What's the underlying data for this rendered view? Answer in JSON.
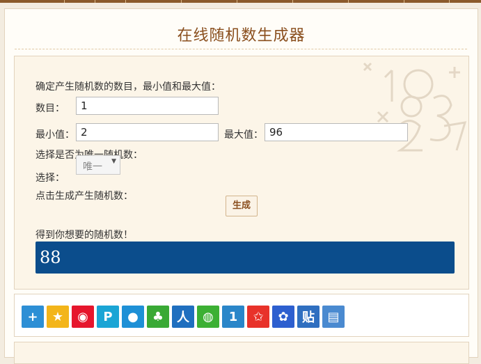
{
  "title": "在线随机数生成器",
  "form": {
    "intro": "确定产生随机数的数目，最小值和最大值：",
    "count_label": "数目：",
    "count_value": "1",
    "min_label": "最小值：",
    "min_value": "2",
    "max_label": "最大值：",
    "max_value": "96",
    "unique_prompt": "选择是否为唯一随机数：",
    "select_label": "选择：",
    "select_value": "唯一",
    "generate_prompt": "点击生成产生随机数：",
    "generate_button": "生成",
    "result_label": "得到你想要的随机数！",
    "result_value": "88"
  },
  "share_icons": [
    {
      "name": "more-share-icon",
      "color": "#2d8fd5",
      "glyph": "+"
    },
    {
      "name": "qzone-icon",
      "color": "#f3b51a",
      "glyph": "★"
    },
    {
      "name": "weibo-icon",
      "color": "#e6162d",
      "glyph": "◉"
    },
    {
      "name": "tencent-weibo-icon",
      "color": "#1aa5d5",
      "glyph": "P"
    },
    {
      "name": "qq-icon",
      "color": "#1e90d6",
      "glyph": "●"
    },
    {
      "name": "clover-icon",
      "color": "#39a935",
      "glyph": "♣"
    },
    {
      "name": "renren-icon",
      "color": "#1f6fbf",
      "glyph": "人"
    },
    {
      "name": "wechat-icon",
      "color": "#3cb034",
      "glyph": "◍"
    },
    {
      "name": "kaixin-icon",
      "color": "#2a86c9",
      "glyph": "1"
    },
    {
      "name": "favorite-star-icon",
      "color": "#e8322a",
      "glyph": "✩"
    },
    {
      "name": "baidu-icon",
      "color": "#2d5fcf",
      "glyph": "✿"
    },
    {
      "name": "tieba-icon",
      "color": "#2f6fc0",
      "glyph": "贴"
    },
    {
      "name": "print-icon",
      "color": "#4a8ad0",
      "glyph": "▤"
    }
  ]
}
